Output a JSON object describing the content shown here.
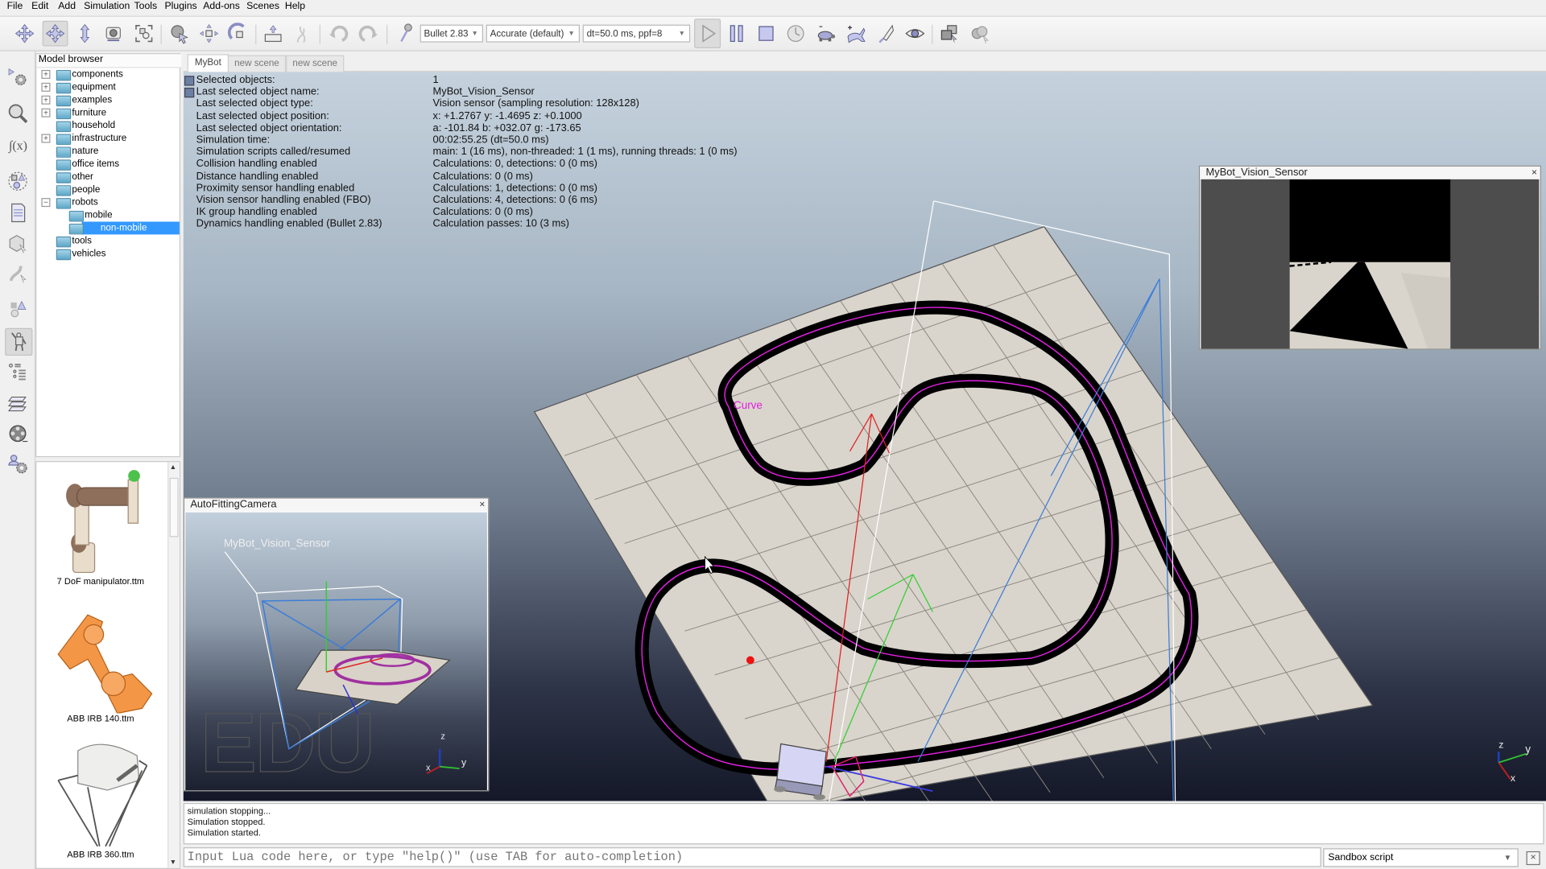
{
  "menu": [
    "File",
    "Edit",
    "Add",
    "Simulation",
    "Tools",
    "Plugins",
    "Add-ons",
    "Scenes",
    "Help"
  ],
  "toolbar": {
    "icons": [
      "camera-pan-icon",
      "camera-rotate-icon",
      "camera-shift-icon",
      "camera-angle-icon",
      "fit-to-view-icon",
      "object-select-icon",
      "object-shift-icon",
      "object-rotate-icon",
      "assemble-icon",
      "transfer-dna-icon",
      "undo-icon",
      "redo-icon",
      "dynamics-engine-icon",
      "start-icon",
      "pause-icon",
      "stop-icon",
      "real-time-icon",
      "slow-down-icon",
      "speed-up-icon",
      "thread-rendering-icon",
      "visualization-icon",
      "page-selector-icon",
      "scene-selector-icon"
    ],
    "engine": "Bullet 2.83",
    "accuracy": "Accurate (default)",
    "timestep": "dt=50.0 ms, ppf=8"
  },
  "left_toolbar": [
    "simulation-settings-icon",
    "scene-browse-icon",
    "script-icon",
    "shape-edit-icon",
    "page-icon",
    "object-properties-icon",
    "path-edit-icon",
    "collections-icon",
    "model-browser-icon",
    "hierarchy-icon",
    "layers-icon",
    "video-recorder-icon",
    "user-settings-icon"
  ],
  "model_browser": {
    "title": "Model browser",
    "items": [
      {
        "label": "components",
        "expandable": true,
        "expanded": false,
        "depth": 0
      },
      {
        "label": "equipment",
        "expandable": true,
        "expanded": false,
        "depth": 0
      },
      {
        "label": "examples",
        "expandable": true,
        "expanded": false,
        "depth": 0
      },
      {
        "label": "furniture",
        "expandable": true,
        "expanded": false,
        "depth": 0
      },
      {
        "label": "household",
        "expandable": false,
        "depth": 0
      },
      {
        "label": "infrastructure",
        "expandable": true,
        "expanded": false,
        "depth": 0
      },
      {
        "label": "nature",
        "expandable": false,
        "depth": 0
      },
      {
        "label": "office items",
        "expandable": false,
        "depth": 0
      },
      {
        "label": "other",
        "expandable": false,
        "depth": 0
      },
      {
        "label": "people",
        "expandable": false,
        "depth": 0
      },
      {
        "label": "robots",
        "expandable": true,
        "expanded": true,
        "depth": 0
      },
      {
        "label": "mobile",
        "expandable": false,
        "depth": 1
      },
      {
        "label": "non-mobile",
        "expandable": false,
        "depth": 1,
        "selected": true
      },
      {
        "label": "tools",
        "expandable": false,
        "depth": 0
      },
      {
        "label": "vehicles",
        "expandable": false,
        "depth": 0
      }
    ],
    "thumbnails": [
      "7 DoF manipulator.ttm",
      "ABB IRB 140.ttm",
      "ABB IRB 360.ttm"
    ]
  },
  "scene_tabs": [
    {
      "label": "MyBot",
      "active": true
    },
    {
      "label": "new scene",
      "active": false
    },
    {
      "label": "new scene",
      "active": false
    }
  ],
  "info": [
    {
      "key": "Selected objects:",
      "value": "1"
    },
    {
      "key": "Last selected object name:",
      "value": "MyBot_Vision_Sensor"
    },
    {
      "key": "Last selected object type:",
      "value": "Vision sensor (sampling resolution: 128x128)"
    },
    {
      "key": "Last selected object position:",
      "value": "x: +1.2767    y: -1.4695    z: +0.1000"
    },
    {
      "key": "Last selected object orientation:",
      "value": "a: -101.84    b: +032.07    g: -173.65"
    },
    {
      "key": "Simulation time:",
      "value": "00:02:55.25 (dt=50.0 ms)"
    },
    {
      "key": "Simulation scripts called/resumed",
      "value": "main: 1 (16 ms), non-threaded: 1 (1 ms), running threads: 1 (0 ms)"
    },
    {
      "key": "Collision handling enabled",
      "value": "Calculations: 0, detections: 0 (0 ms)"
    },
    {
      "key": "Distance handling enabled",
      "value": "Calculations: 0 (0 ms)"
    },
    {
      "key": "Proximity sensor handling enabled",
      "value": "Calculations: 1, detections: 0 (0 ms)"
    },
    {
      "key": "Vision sensor handling enabled (FBO)",
      "value": "Calculations: 4, detections: 0 (6 ms)"
    },
    {
      "key": "IK group handling enabled",
      "value": "Calculations: 0 (0 ms)"
    },
    {
      "key": "Dynamics handling enabled (Bullet 2.83)",
      "value": "Calculation passes: 10 (3 ms)"
    }
  ],
  "scene": {
    "curve_label": "Curve",
    "axis_labels": {
      "x": "x",
      "y": "y",
      "z": "z"
    },
    "colors": {
      "track": "#000000",
      "curve": "#e020e0",
      "floor": "#d9d4cc"
    }
  },
  "vision_view": {
    "title": "MyBot_Vision_Sensor",
    "close": "×"
  },
  "camera_view": {
    "title": "AutoFittingCamera",
    "close": "×",
    "object_label": "MyBot_Vision_Sensor",
    "watermark": "EDU"
  },
  "console": {
    "lines": [
      "simulation stopping...",
      "Simulation stopped.",
      "Simulation started."
    ],
    "input_placeholder": "Input Lua code here, or type \"help()\" (use TAB for auto-completion)",
    "script_mode": "Sandbox script",
    "close": "×"
  }
}
